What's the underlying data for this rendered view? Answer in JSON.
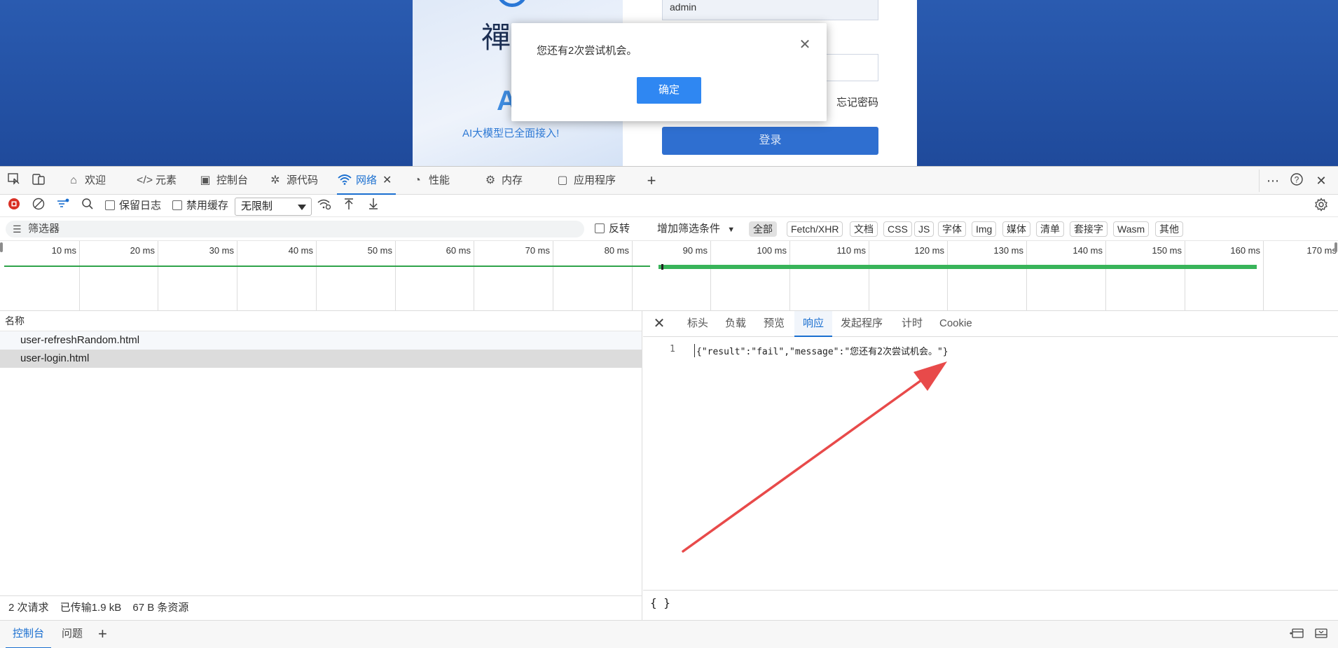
{
  "page": {
    "username_value": "admin",
    "forgot_password": "忘记密码",
    "login_button": "登录",
    "logo_text": "禪",
    "big_letter": "A",
    "ai_tagline": "AI大模型已全面接入!"
  },
  "modal": {
    "message": "您还有2次尝试机会。",
    "ok_label": "确定",
    "close_glyph": "✕"
  },
  "devtools": {
    "tabs": [
      {
        "label": "欢迎",
        "icon": "home-icon"
      },
      {
        "label": "元素",
        "icon": "code-icon"
      },
      {
        "label": "控制台",
        "icon": "console-icon"
      },
      {
        "label": "源代码",
        "icon": "bug-icon"
      },
      {
        "label": "网络",
        "icon": "wifi-icon",
        "active": true
      },
      {
        "label": "性能",
        "icon": "gauge-icon"
      },
      {
        "label": "内存",
        "icon": "chip-icon"
      },
      {
        "label": "应用程序",
        "icon": "window-icon"
      }
    ],
    "toolbar": {
      "preserve_log": "保留日志",
      "disable_cache": "禁用缓存",
      "throttle": "无限制"
    },
    "filter": {
      "placeholder": "筛选器",
      "invert": "反转",
      "add_filter": "增加筛选条件",
      "types": [
        "全部",
        "Fetch/XHR",
        "文档",
        "CSS",
        "JS",
        "字体",
        "Img",
        "媒体",
        "清单",
        "套接字",
        "Wasm",
        "其他"
      ]
    },
    "timeline_ticks": [
      "10 ms",
      "20 ms",
      "30 ms",
      "40 ms",
      "50 ms",
      "60 ms",
      "70 ms",
      "80 ms",
      "90 ms",
      "100 ms",
      "110 ms",
      "120 ms",
      "130 ms",
      "140 ms",
      "150 ms",
      "160 ms",
      "170 ms"
    ],
    "requests": {
      "header": "名称",
      "rows": [
        {
          "name": "user-refreshRandom.html"
        },
        {
          "name": "user-login.html",
          "selected": true
        }
      ]
    },
    "details": {
      "tabs": [
        "标头",
        "负载",
        "预览",
        "响应",
        "发起程序",
        "计时",
        "Cookie"
      ],
      "active_tab": "响应",
      "line_number": "1",
      "response_body": "{\"result\":\"fail\",\"message\":\"您还有2次尝试机会。\"}",
      "pretty_print": "{ }"
    },
    "status": {
      "requests": "2 次请求",
      "transferred": "已传输1.9 kB",
      "resources": "67 B 条资源"
    },
    "drawer": {
      "tabs": [
        "控制台",
        "问题"
      ]
    }
  },
  "colors": {
    "accent": "#1a6fd0",
    "modal_button": "#2f87f2",
    "arrow": "#e84a4a",
    "timeline_bar": "#38b45a"
  }
}
